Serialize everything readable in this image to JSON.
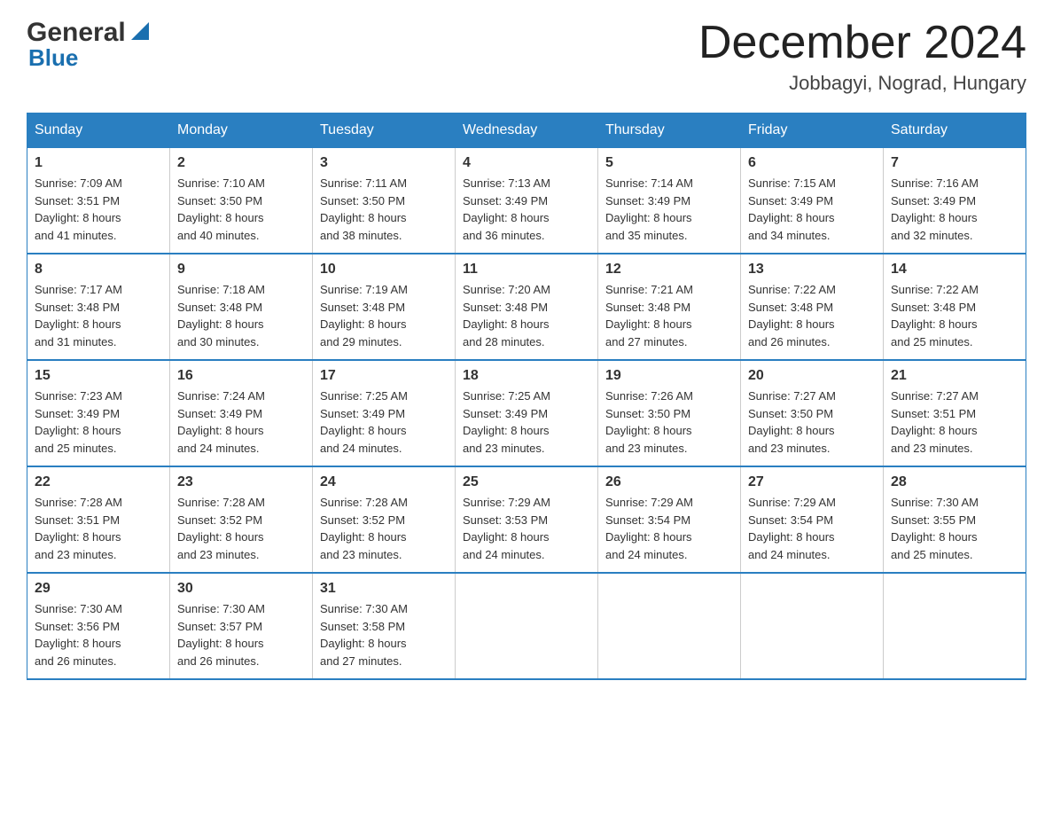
{
  "logo": {
    "name": "General",
    "name2": "Blue"
  },
  "title": "December 2024",
  "subtitle": "Jobbagyi, Nograd, Hungary",
  "weekdays": [
    "Sunday",
    "Monday",
    "Tuesday",
    "Wednesday",
    "Thursday",
    "Friday",
    "Saturday"
  ],
  "weeks": [
    [
      {
        "day": "1",
        "sunrise": "7:09 AM",
        "sunset": "3:51 PM",
        "daylight": "8 hours and 41 minutes."
      },
      {
        "day": "2",
        "sunrise": "7:10 AM",
        "sunset": "3:50 PM",
        "daylight": "8 hours and 40 minutes."
      },
      {
        "day": "3",
        "sunrise": "7:11 AM",
        "sunset": "3:50 PM",
        "daylight": "8 hours and 38 minutes."
      },
      {
        "day": "4",
        "sunrise": "7:13 AM",
        "sunset": "3:49 PM",
        "daylight": "8 hours and 36 minutes."
      },
      {
        "day": "5",
        "sunrise": "7:14 AM",
        "sunset": "3:49 PM",
        "daylight": "8 hours and 35 minutes."
      },
      {
        "day": "6",
        "sunrise": "7:15 AM",
        "sunset": "3:49 PM",
        "daylight": "8 hours and 34 minutes."
      },
      {
        "day": "7",
        "sunrise": "7:16 AM",
        "sunset": "3:49 PM",
        "daylight": "8 hours and 32 minutes."
      }
    ],
    [
      {
        "day": "8",
        "sunrise": "7:17 AM",
        "sunset": "3:48 PM",
        "daylight": "8 hours and 31 minutes."
      },
      {
        "day": "9",
        "sunrise": "7:18 AM",
        "sunset": "3:48 PM",
        "daylight": "8 hours and 30 minutes."
      },
      {
        "day": "10",
        "sunrise": "7:19 AM",
        "sunset": "3:48 PM",
        "daylight": "8 hours and 29 minutes."
      },
      {
        "day": "11",
        "sunrise": "7:20 AM",
        "sunset": "3:48 PM",
        "daylight": "8 hours and 28 minutes."
      },
      {
        "day": "12",
        "sunrise": "7:21 AM",
        "sunset": "3:48 PM",
        "daylight": "8 hours and 27 minutes."
      },
      {
        "day": "13",
        "sunrise": "7:22 AM",
        "sunset": "3:48 PM",
        "daylight": "8 hours and 26 minutes."
      },
      {
        "day": "14",
        "sunrise": "7:22 AM",
        "sunset": "3:48 PM",
        "daylight": "8 hours and 25 minutes."
      }
    ],
    [
      {
        "day": "15",
        "sunrise": "7:23 AM",
        "sunset": "3:49 PM",
        "daylight": "8 hours and 25 minutes."
      },
      {
        "day": "16",
        "sunrise": "7:24 AM",
        "sunset": "3:49 PM",
        "daylight": "8 hours and 24 minutes."
      },
      {
        "day": "17",
        "sunrise": "7:25 AM",
        "sunset": "3:49 PM",
        "daylight": "8 hours and 24 minutes."
      },
      {
        "day": "18",
        "sunrise": "7:25 AM",
        "sunset": "3:49 PM",
        "daylight": "8 hours and 23 minutes."
      },
      {
        "day": "19",
        "sunrise": "7:26 AM",
        "sunset": "3:50 PM",
        "daylight": "8 hours and 23 minutes."
      },
      {
        "day": "20",
        "sunrise": "7:27 AM",
        "sunset": "3:50 PM",
        "daylight": "8 hours and 23 minutes."
      },
      {
        "day": "21",
        "sunrise": "7:27 AM",
        "sunset": "3:51 PM",
        "daylight": "8 hours and 23 minutes."
      }
    ],
    [
      {
        "day": "22",
        "sunrise": "7:28 AM",
        "sunset": "3:51 PM",
        "daylight": "8 hours and 23 minutes."
      },
      {
        "day": "23",
        "sunrise": "7:28 AM",
        "sunset": "3:52 PM",
        "daylight": "8 hours and 23 minutes."
      },
      {
        "day": "24",
        "sunrise": "7:28 AM",
        "sunset": "3:52 PM",
        "daylight": "8 hours and 23 minutes."
      },
      {
        "day": "25",
        "sunrise": "7:29 AM",
        "sunset": "3:53 PM",
        "daylight": "8 hours and 24 minutes."
      },
      {
        "day": "26",
        "sunrise": "7:29 AM",
        "sunset": "3:54 PM",
        "daylight": "8 hours and 24 minutes."
      },
      {
        "day": "27",
        "sunrise": "7:29 AM",
        "sunset": "3:54 PM",
        "daylight": "8 hours and 24 minutes."
      },
      {
        "day": "28",
        "sunrise": "7:30 AM",
        "sunset": "3:55 PM",
        "daylight": "8 hours and 25 minutes."
      }
    ],
    [
      {
        "day": "29",
        "sunrise": "7:30 AM",
        "sunset": "3:56 PM",
        "daylight": "8 hours and 26 minutes."
      },
      {
        "day": "30",
        "sunrise": "7:30 AM",
        "sunset": "3:57 PM",
        "daylight": "8 hours and 26 minutes."
      },
      {
        "day": "31",
        "sunrise": "7:30 AM",
        "sunset": "3:58 PM",
        "daylight": "8 hours and 27 minutes."
      },
      null,
      null,
      null,
      null
    ]
  ]
}
